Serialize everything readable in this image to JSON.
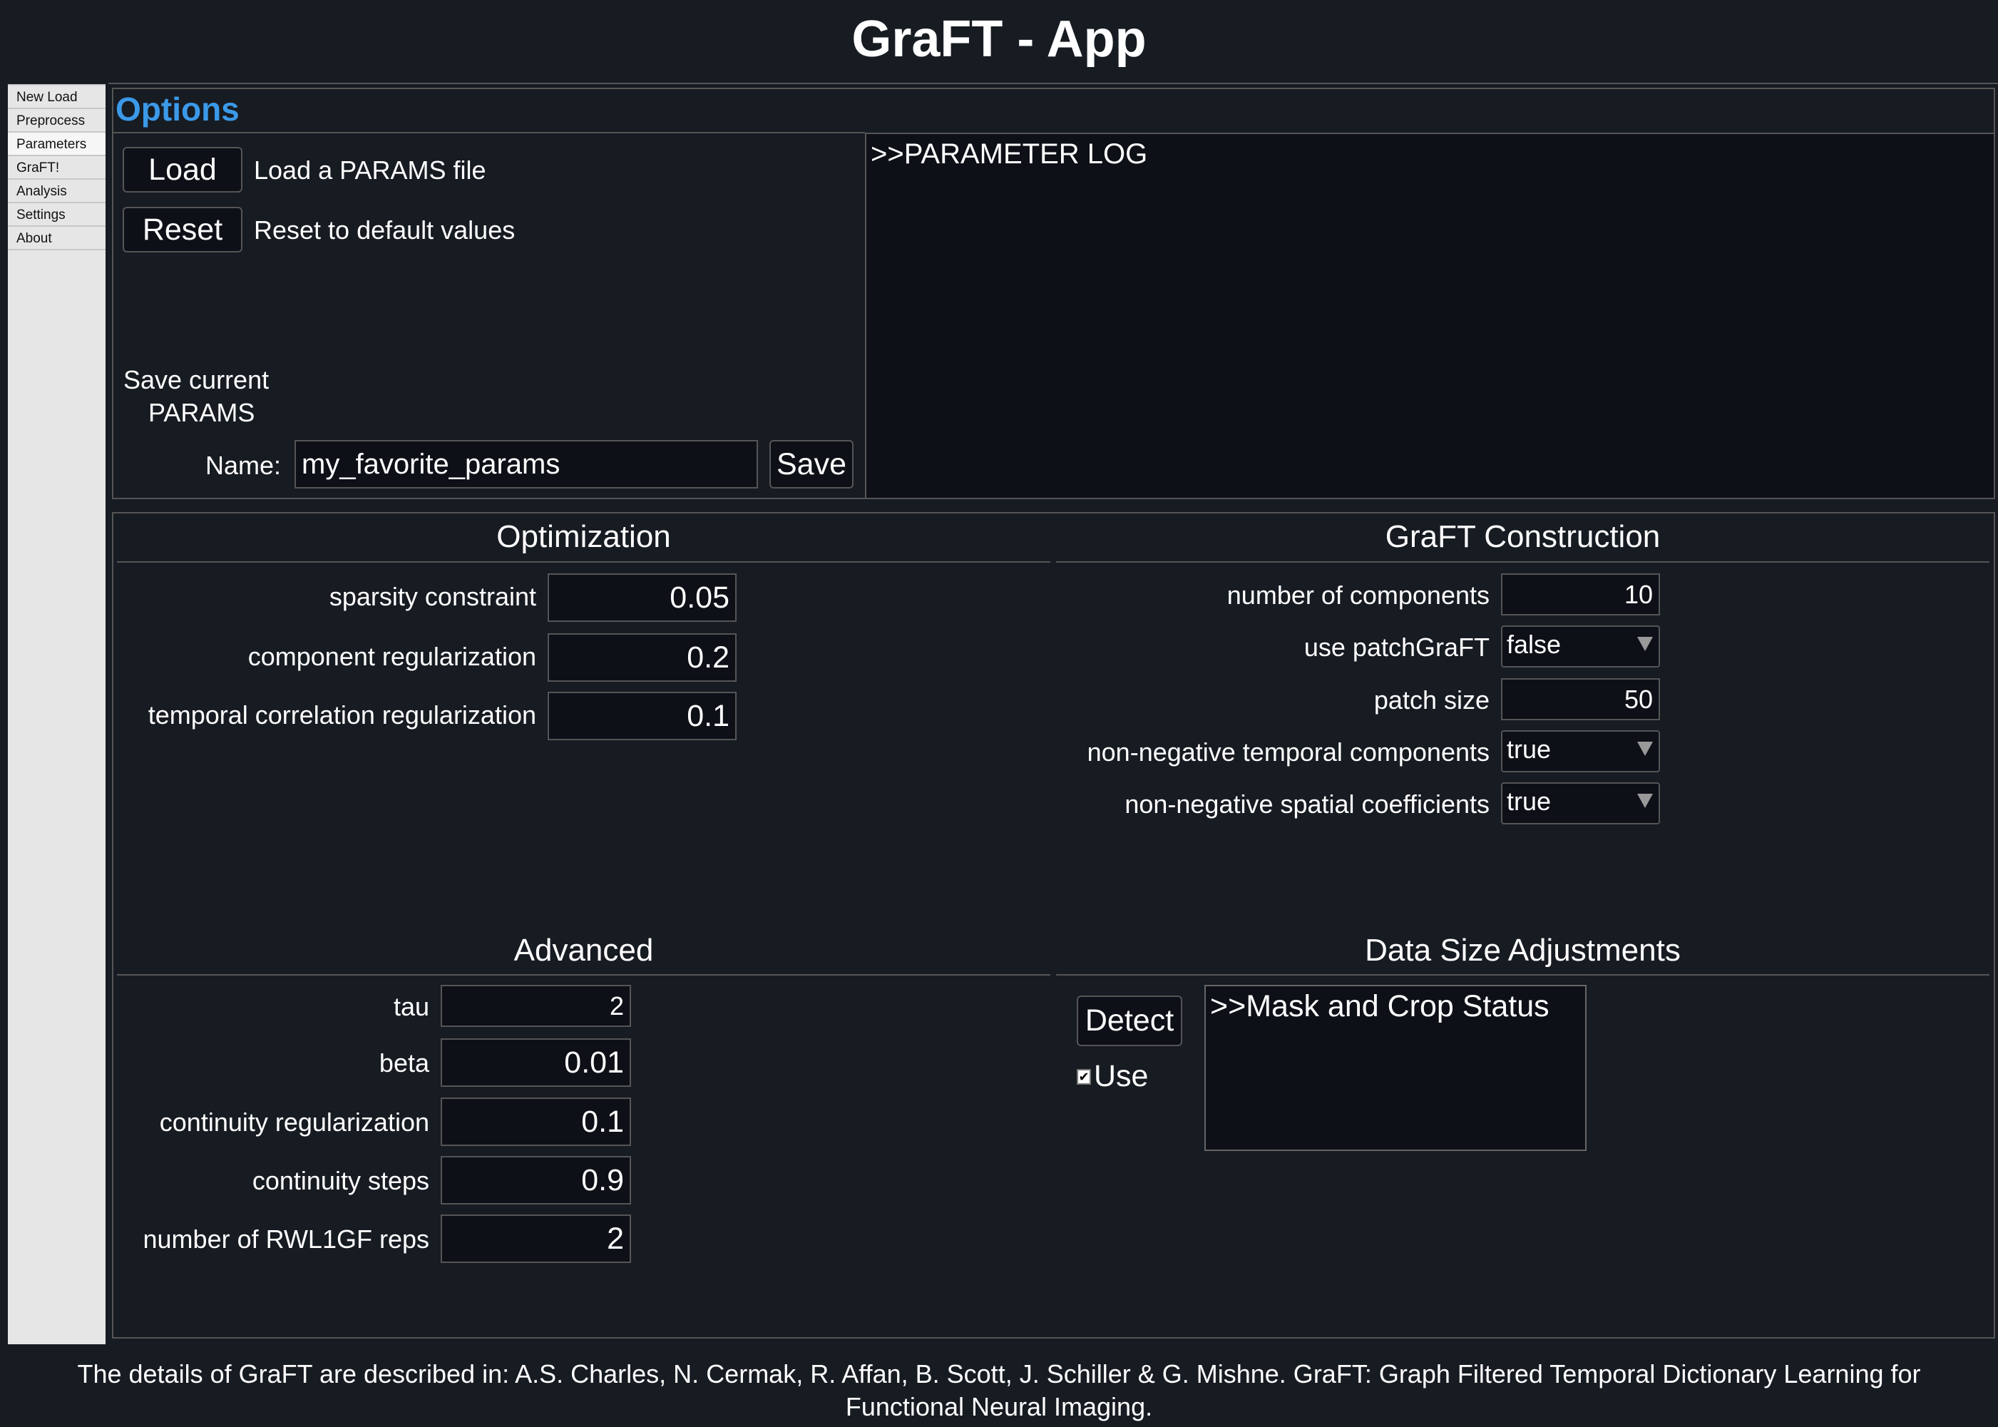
{
  "app_title": "GraFT - App",
  "sidebar": {
    "items": [
      {
        "label": "New Load"
      },
      {
        "label": "Preprocess"
      },
      {
        "label": "Parameters",
        "active": true
      },
      {
        "label": "GraFT!"
      },
      {
        "label": "Analysis"
      },
      {
        "label": "Settings"
      },
      {
        "label": "About"
      }
    ]
  },
  "options": {
    "title": "Options",
    "accent": "#3b99e8",
    "load_button": "Load",
    "load_desc": "Load a PARAMS file",
    "reset_button": "Reset",
    "reset_desc": "Reset to default values",
    "save_heading_1": "Save current",
    "save_heading_2": "PARAMS",
    "name_label": "Name:",
    "name_value": "my_favorite_params",
    "save_button": "Save",
    "log_text": ">>PARAMETER LOG"
  },
  "optimization": {
    "title": "Optimization",
    "fields": [
      {
        "label": "sparsity constraint",
        "value": "0.05"
      },
      {
        "label": "component regularization",
        "value": "0.2"
      },
      {
        "label": "temporal correlation regularization",
        "value": "0.1"
      }
    ]
  },
  "construction": {
    "title": "GraFT Construction",
    "fields": [
      {
        "label": "number of components",
        "value": "10"
      },
      {
        "label": "use patchGraFT",
        "value": "false"
      },
      {
        "label": "patch size",
        "value": "50"
      },
      {
        "label": "non-negative temporal components",
        "value": "true"
      },
      {
        "label": "non-negative spatial coefficients",
        "value": "true"
      }
    ]
  },
  "advanced": {
    "title": "Advanced",
    "fields": [
      {
        "label": "tau",
        "value": "2"
      },
      {
        "label": "beta",
        "value": "0.01"
      },
      {
        "label": "continuity regularization",
        "value": "0.1"
      },
      {
        "label": "continuity steps",
        "value": "0.9"
      },
      {
        "label": "number of RWL1GF reps",
        "value": "2"
      }
    ]
  },
  "data_size": {
    "title": "Data Size Adjustments",
    "detect_button": "Detect",
    "use_label": "Use",
    "use_checked": true,
    "status_text": ">>Mask and Crop Status"
  },
  "footer": {
    "line1": "The details of GraFT are described in: A.S. Charles, N. Cermak, R. Affan, B. Scott, J. Schiller & G. Mishne. GraFT: Graph Filtered Temporal Dictionary Learning for",
    "line2": "Functional Neural Imaging."
  }
}
